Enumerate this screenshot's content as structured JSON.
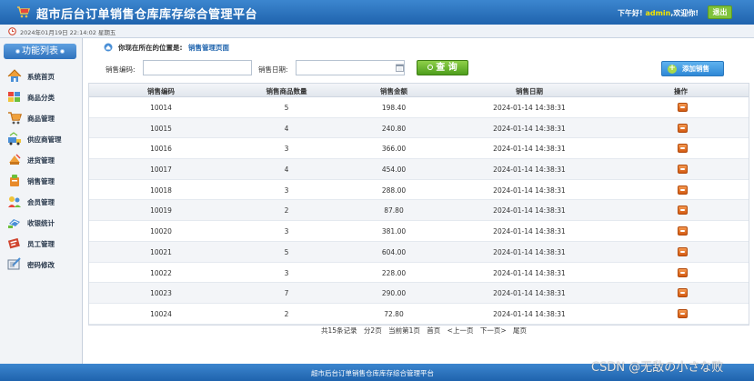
{
  "header": {
    "title": "超市后台订单销售仓库库存综合管理平台",
    "greeting_prefix": "下午好!",
    "username": "admin",
    "greeting_suffix": ",欢迎你!",
    "logout_label": "退出"
  },
  "datebar": {
    "datetime": "2024年01月19日 22:14:02 星期五"
  },
  "sidebar": {
    "title": "功能列表",
    "items": [
      {
        "label": "系统首页",
        "icon": "home-icon"
      },
      {
        "label": "商品分类",
        "icon": "category-icon"
      },
      {
        "label": "商品管理",
        "icon": "cart-icon"
      },
      {
        "label": "供应商管理",
        "icon": "supplier-icon"
      },
      {
        "label": "进货管理",
        "icon": "purchase-icon"
      },
      {
        "label": "销售管理",
        "icon": "sales-icon"
      },
      {
        "label": "会员管理",
        "icon": "members-icon"
      },
      {
        "label": "收银统计",
        "icon": "cashier-icon"
      },
      {
        "label": "员工管理",
        "icon": "staff-icon"
      },
      {
        "label": "密码修改",
        "icon": "password-icon"
      }
    ]
  },
  "location": {
    "label": "你现在所在的位置是:",
    "value": "销售管理页面"
  },
  "filters": {
    "code_label": "销售编码:",
    "code_value": "",
    "date_label": "销售日期:",
    "date_value": "",
    "search_label": "查 询",
    "add_label": "添加销售"
  },
  "table": {
    "headers": [
      "销售编码",
      "销售商品数量",
      "销售金额",
      "销售日期",
      "操作"
    ],
    "rows": [
      [
        "10014",
        "5",
        "198.40",
        "2024-01-14 14:38:31"
      ],
      [
        "10015",
        "4",
        "240.80",
        "2024-01-14 14:38:31"
      ],
      [
        "10016",
        "3",
        "366.00",
        "2024-01-14 14:38:31"
      ],
      [
        "10017",
        "4",
        "454.00",
        "2024-01-14 14:38:31"
      ],
      [
        "10018",
        "3",
        "288.00",
        "2024-01-14 14:38:31"
      ],
      [
        "10019",
        "2",
        "87.80",
        "2024-01-14 14:38:31"
      ],
      [
        "10020",
        "3",
        "381.00",
        "2024-01-14 14:38:31"
      ],
      [
        "10021",
        "5",
        "604.00",
        "2024-01-14 14:38:31"
      ],
      [
        "10022",
        "3",
        "228.00",
        "2024-01-14 14:38:31"
      ],
      [
        "10023",
        "7",
        "290.00",
        "2024-01-14 14:38:31"
      ],
      [
        "10024",
        "2",
        "72.80",
        "2024-01-14 14:38:31"
      ]
    ]
  },
  "pager": {
    "total": "共15条记录",
    "pages": "分2页",
    "current": "当前第1页",
    "first": "首页",
    "prev": "<上一页",
    "next": "下一页>",
    "last": "尾页"
  },
  "footer": {
    "text": "超市后台订单销售仓库库存综合管理平台"
  },
  "watermark": "CSDN @无敌の小さな败"
}
